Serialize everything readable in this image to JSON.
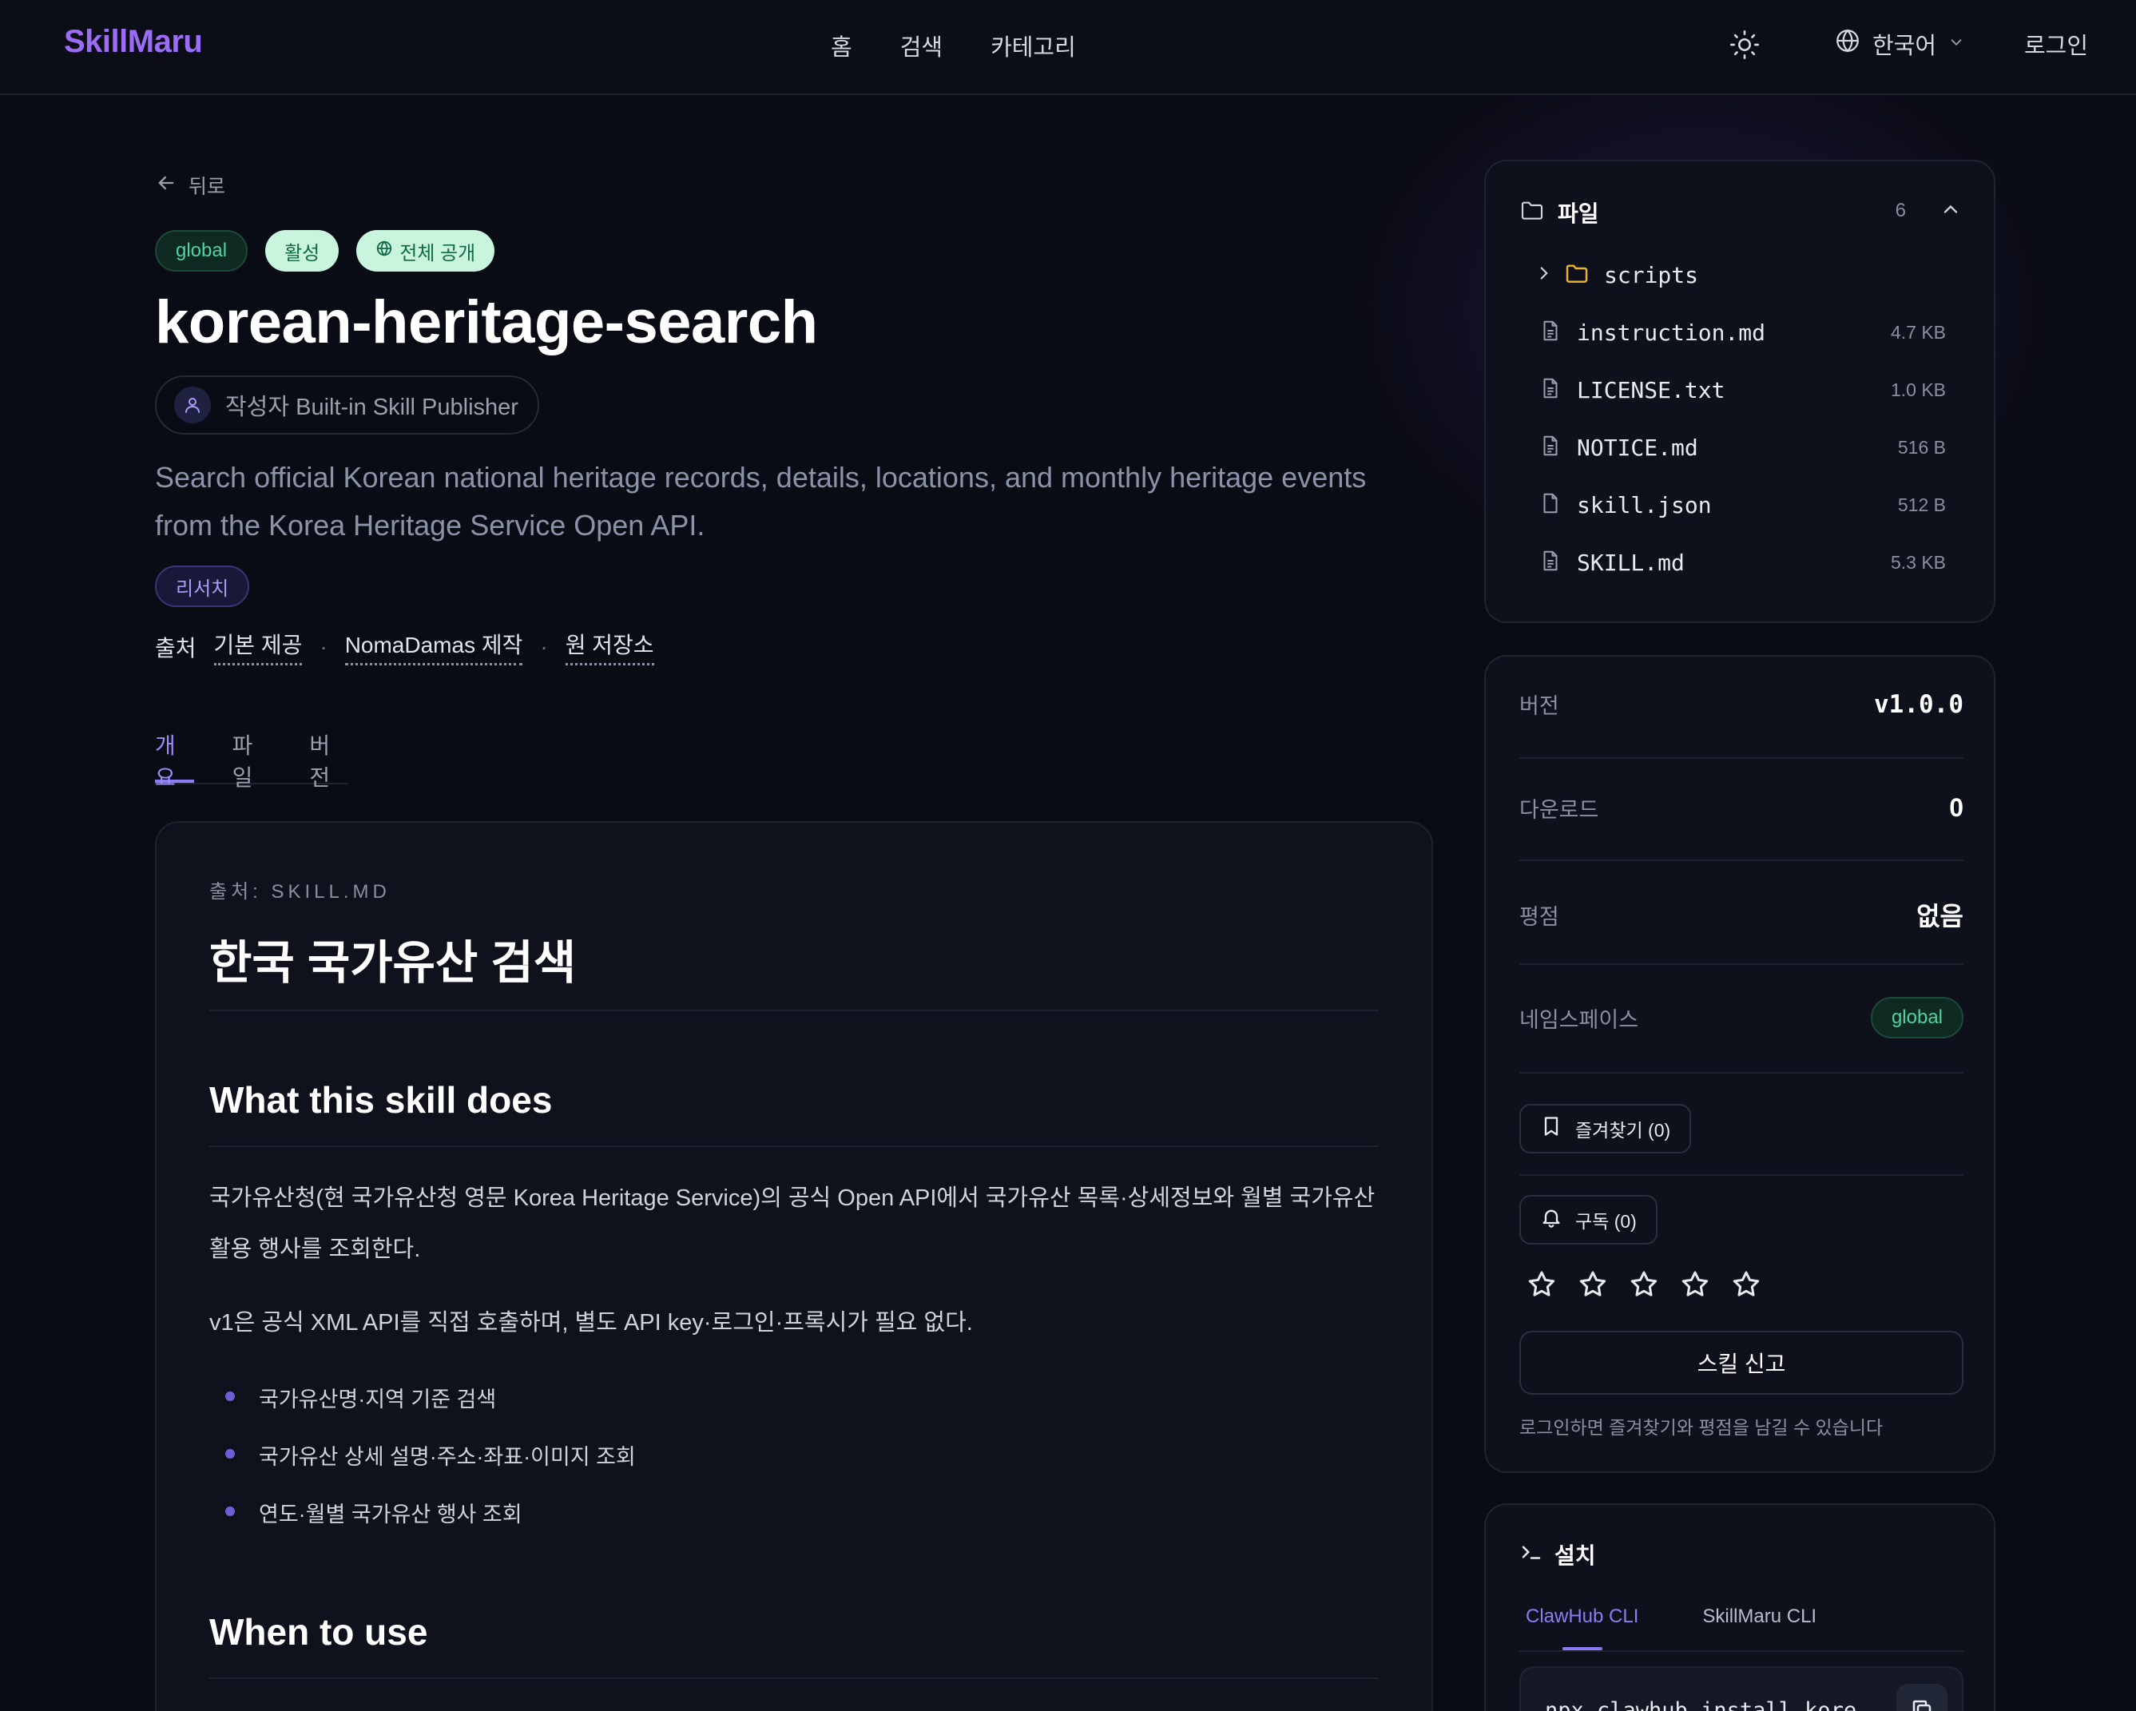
{
  "header": {
    "brand": "SkillMaru",
    "nav": [
      "홈",
      "검색",
      "카테고리"
    ],
    "language": "한국어",
    "login": "로그인"
  },
  "skill": {
    "back": "뒤로",
    "badges": {
      "namespace": "global",
      "status": "활성",
      "visibility": "전체 공개"
    },
    "title": "korean-heritage-search",
    "author": "작성자 Built-in Skill Publisher",
    "description": "Search official Korean national heritage records, details, locations, and monthly heritage events from the Korea Heritage Service Open API.",
    "tag": "리서치",
    "source": {
      "label": "출처",
      "provider": "기본 제공",
      "maker": "NomaDamas 제작",
      "repo": "원 저장소"
    },
    "tabs": [
      "개요",
      "파일",
      "버전"
    ]
  },
  "doc": {
    "source": "출처: SKILL.MD",
    "h1": "한국 국가유산 검색",
    "section1": "What this skill does",
    "p1": "국가유산청(현 국가유산청 영문 Korea Heritage Service)의 공식 Open API에서 국가유산 목록·상세정보와 월별 국가유산 활용 행사를 조회한다.",
    "p2": "v1은 공식 XML API를 직접 호출하며, 별도 API key·로그인·프록시가 필요 없다.",
    "list": [
      "국가유산명·지역 기준 검색",
      "국가유산 상세 설명·주소·좌표·이미지 조회",
      "연도·월별 국가유산 행사 조회"
    ],
    "section2": "When to use"
  },
  "files": {
    "title": "파일",
    "count": "6",
    "folder": "scripts",
    "items": [
      {
        "name": "instruction.md",
        "size": "4.7 KB"
      },
      {
        "name": "LICENSE.txt",
        "size": "1.0 KB"
      },
      {
        "name": "NOTICE.md",
        "size": "516 B"
      },
      {
        "name": "skill.json",
        "size": "512 B"
      },
      {
        "name": "SKILL.md",
        "size": "5.3 KB"
      }
    ]
  },
  "meta": {
    "version_label": "버전",
    "version": "v1.0.0",
    "downloads_label": "다운로드",
    "downloads": "0",
    "rating_label": "평점",
    "rating": "없음",
    "namespace_label": "네임스페이스",
    "namespace": "global",
    "bookmark": "즐겨찾기 (0)",
    "subscribe": "구독 (0)",
    "star_rating": 0,
    "report": "스킬 신고",
    "login_note": "로그인하면 즐겨찾기와 평점을 남길 수 있습니다"
  },
  "install": {
    "title": "설치",
    "tabs": [
      "ClawHub CLI",
      "SkillMaru CLI"
    ],
    "command": "npx clawhub install kore"
  },
  "colors": {
    "background": "#0a0c15",
    "accent": "#8b7cf5",
    "brand": "#9b6cf5",
    "success": "#4fd3a0"
  }
}
